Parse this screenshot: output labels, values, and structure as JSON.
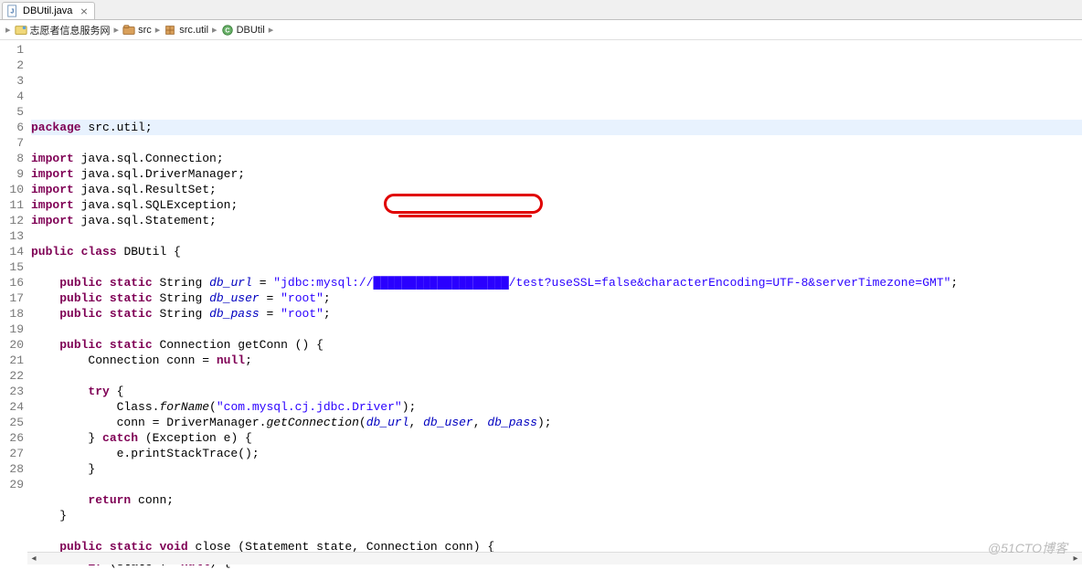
{
  "tab": {
    "filename": "DBUtil.java",
    "close_glyph": "⨯"
  },
  "breadcrumb": {
    "items": [
      {
        "label": "志愿者信息服务网"
      },
      {
        "label": "src"
      },
      {
        "label": "src.util"
      },
      {
        "label": "DBUtil"
      }
    ]
  },
  "code": {
    "lines": [
      {
        "n": 1,
        "tokens": [
          [
            "kw",
            "package"
          ],
          [
            "",
            " src.util;"
          ]
        ],
        "current": true
      },
      {
        "n": 2,
        "tokens": []
      },
      {
        "n": 3,
        "tokens": [
          [
            "kw",
            "import"
          ],
          [
            "",
            " java.sql.Connection;"
          ]
        ]
      },
      {
        "n": 4,
        "tokens": [
          [
            "kw",
            "import"
          ],
          [
            "",
            " java.sql.DriverManager;"
          ]
        ]
      },
      {
        "n": 5,
        "tokens": [
          [
            "kw",
            "import"
          ],
          [
            "",
            " java.sql.ResultSet;"
          ]
        ]
      },
      {
        "n": 6,
        "tokens": [
          [
            "kw",
            "import"
          ],
          [
            "",
            " java.sql.SQLException;"
          ]
        ]
      },
      {
        "n": 7,
        "tokens": [
          [
            "kw",
            "import"
          ],
          [
            "",
            " java.sql.Statement;"
          ]
        ]
      },
      {
        "n": 8,
        "tokens": []
      },
      {
        "n": 9,
        "tokens": [
          [
            "kw",
            "public"
          ],
          [
            "",
            " "
          ],
          [
            "kw",
            "class"
          ],
          [
            "",
            " DBUtil {"
          ]
        ]
      },
      {
        "n": 10,
        "tokens": []
      },
      {
        "n": 11,
        "tokens": [
          [
            "",
            "    "
          ],
          [
            "kw",
            "public"
          ],
          [
            "",
            " "
          ],
          [
            "kw",
            "static"
          ],
          [
            "",
            " String "
          ],
          [
            "fld",
            "db_url"
          ],
          [
            "",
            " = "
          ],
          [
            "str",
            "\"jdbc:mysql://███████████████████/test?useSSL=false&characterEncoding=UTF-8&serverTimezone=GMT\""
          ],
          [
            "",
            ";"
          ]
        ]
      },
      {
        "n": 12,
        "tokens": [
          [
            "",
            "    "
          ],
          [
            "kw",
            "public"
          ],
          [
            "",
            " "
          ],
          [
            "kw",
            "static"
          ],
          [
            "",
            " String "
          ],
          [
            "fld",
            "db_user"
          ],
          [
            "",
            " = "
          ],
          [
            "str",
            "\"root\""
          ],
          [
            "",
            ";"
          ]
        ]
      },
      {
        "n": 13,
        "tokens": [
          [
            "",
            "    "
          ],
          [
            "kw",
            "public"
          ],
          [
            "",
            " "
          ],
          [
            "kw",
            "static"
          ],
          [
            "",
            " String "
          ],
          [
            "fld",
            "db_pass"
          ],
          [
            "",
            " = "
          ],
          [
            "str",
            "\"root\""
          ],
          [
            "",
            ";"
          ]
        ]
      },
      {
        "n": 14,
        "tokens": []
      },
      {
        "n": 15,
        "tokens": [
          [
            "",
            "    "
          ],
          [
            "kw",
            "public"
          ],
          [
            "",
            " "
          ],
          [
            "kw",
            "static"
          ],
          [
            "",
            " Connection getConn () {"
          ]
        ]
      },
      {
        "n": 16,
        "tokens": [
          [
            "",
            "        Connection conn = "
          ],
          [
            "kw",
            "null"
          ],
          [
            "",
            ";"
          ]
        ]
      },
      {
        "n": 17,
        "tokens": []
      },
      {
        "n": 18,
        "tokens": [
          [
            "",
            "        "
          ],
          [
            "kw",
            "try"
          ],
          [
            "",
            " {"
          ]
        ]
      },
      {
        "n": 19,
        "tokens": [
          [
            "",
            "            Class."
          ],
          [
            "smethod",
            "forName"
          ],
          [
            "",
            "("
          ],
          [
            "str",
            "\"com.mysql.cj.jdbc.Driver\""
          ],
          [
            "",
            ");"
          ]
        ]
      },
      {
        "n": 20,
        "tokens": [
          [
            "",
            "            conn = DriverManager."
          ],
          [
            "smethod",
            "getConnection"
          ],
          [
            "",
            "("
          ],
          [
            "fld",
            "db_url"
          ],
          [
            "",
            ", "
          ],
          [
            "fld",
            "db_user"
          ],
          [
            "",
            ", "
          ],
          [
            "fld",
            "db_pass"
          ],
          [
            "",
            ");"
          ]
        ]
      },
      {
        "n": 21,
        "tokens": [
          [
            "",
            "        } "
          ],
          [
            "kw",
            "catch"
          ],
          [
            "",
            " (Exception e) {"
          ]
        ]
      },
      {
        "n": 22,
        "tokens": [
          [
            "",
            "            e.printStackTrace();"
          ]
        ]
      },
      {
        "n": 23,
        "tokens": [
          [
            "",
            "        }"
          ]
        ]
      },
      {
        "n": 24,
        "tokens": []
      },
      {
        "n": 25,
        "tokens": [
          [
            "",
            "        "
          ],
          [
            "kw",
            "return"
          ],
          [
            "",
            " conn;"
          ]
        ]
      },
      {
        "n": 26,
        "tokens": [
          [
            "",
            "    }"
          ]
        ]
      },
      {
        "n": 27,
        "tokens": []
      },
      {
        "n": 28,
        "tokens": [
          [
            "",
            "    "
          ],
          [
            "kw",
            "public"
          ],
          [
            "",
            " "
          ],
          [
            "kw",
            "static"
          ],
          [
            "",
            " "
          ],
          [
            "kw",
            "void"
          ],
          [
            "",
            " close (Statement state, Connection conn) {"
          ]
        ]
      },
      {
        "n": 29,
        "tokens": [
          [
            "",
            "        "
          ],
          [
            "kw",
            "if"
          ],
          [
            "",
            " (state != "
          ],
          [
            "kw",
            "null"
          ],
          [
            "",
            ") {"
          ]
        ]
      }
    ]
  },
  "watermark": "@51CTO博客",
  "scroll": {
    "left_glyph": "◂",
    "right_glyph": "▸"
  }
}
